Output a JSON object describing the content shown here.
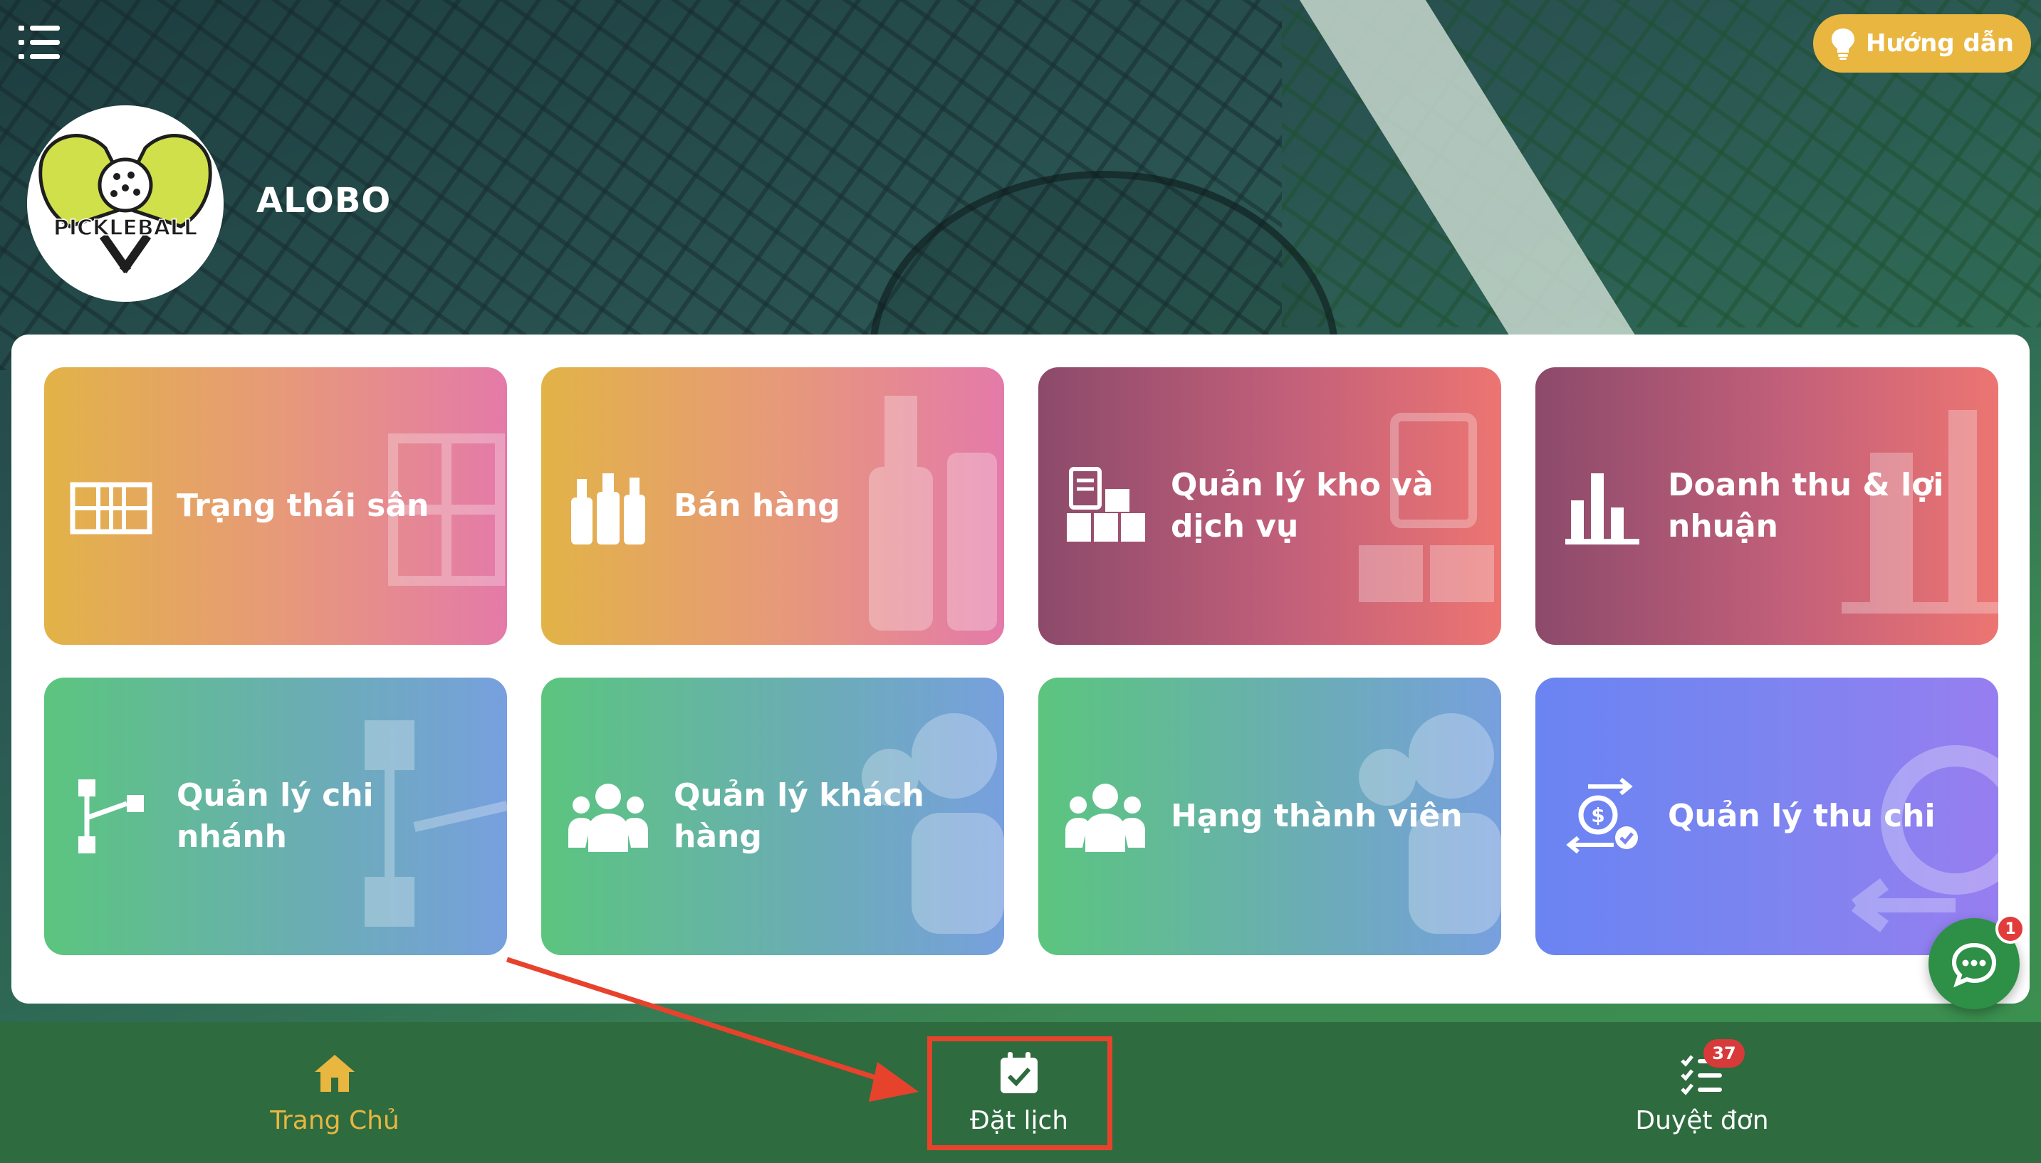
{
  "header": {
    "menu_icon": "list-menu-icon",
    "guide_button": {
      "label": "Hướng dẫn",
      "icon": "lightbulb-icon"
    }
  },
  "brand": {
    "name": "ALOBO",
    "logo_text": "PICKLEBALL"
  },
  "cards": [
    {
      "label": "Trạng thái sân",
      "icon": "court-grid-icon"
    },
    {
      "label": "Bán hàng",
      "icon": "bottles-icon"
    },
    {
      "label": "Quản lý kho và dịch vụ",
      "icon": "warehouse-boxes-icon"
    },
    {
      "label": "Doanh thu & lợi nhuận",
      "icon": "bar-chart-icon"
    },
    {
      "label": "Quản lý chi nhánh",
      "icon": "branch-tree-icon"
    },
    {
      "label": "Quản lý khách hàng",
      "icon": "users-group-icon"
    },
    {
      "label": "Hạng thành viên",
      "icon": "users-group-icon"
    },
    {
      "label": "Quản lý thu chi",
      "icon": "money-exchange-icon"
    }
  ],
  "chat": {
    "icon": "chat-bubble-icon",
    "badge_count": "1"
  },
  "bottom_nav": {
    "items": [
      {
        "label": "Trang Chủ",
        "icon": "home-icon",
        "active": true
      },
      {
        "label": "Đặt lịch",
        "icon": "calendar-check-icon",
        "active": false
      },
      {
        "label": "Duyệt đơn",
        "icon": "checklist-icon",
        "active": false,
        "badge": "37"
      }
    ]
  },
  "colors": {
    "nav_bg": "#2e6b3f",
    "accent_gold": "#e9b640",
    "annotation_red": "#e7432c",
    "badge_red": "#d83a3a"
  }
}
